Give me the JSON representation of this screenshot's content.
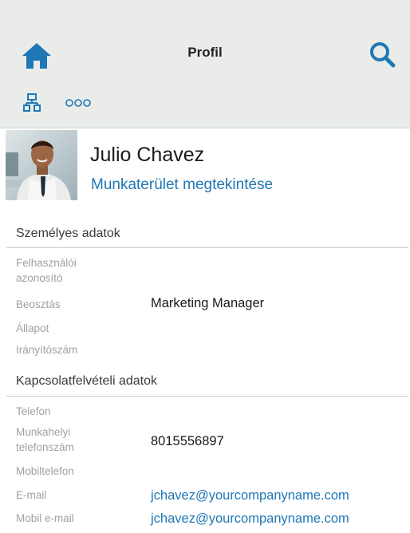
{
  "header": {
    "title": "Profil",
    "home_icon": "home-icon",
    "search_icon": "search-icon",
    "org_chart_icon": "org-chart-icon",
    "more_icon": "more-options-icon",
    "more_label": "ooo",
    "accent_color": "#1f77b5"
  },
  "profile": {
    "name": "Julio Chavez",
    "workspace_link": "Munkaterület megtekintése"
  },
  "personal": {
    "title": "Személyes adatok",
    "user_id_label": "Felhasználói azonosító",
    "position_label": "Beosztás",
    "position_value": "Marketing Manager",
    "status_label": "Állapot",
    "postal_label": "Irányítószám"
  },
  "contact": {
    "title": "Kapcsolatfelvételi adatok",
    "phone_label": "Telefon",
    "work_phone_label": "Munkahelyi telefonszám",
    "work_phone_value": "8015556897",
    "mobile_label": "Mobiltelefon",
    "email_label": "E-mail",
    "email_value": "jchavez@yourcompanyname.com",
    "mobile_email_label": "Mobil e-mail",
    "mobile_email_value": "jchavez@yourcompanyname.com"
  }
}
